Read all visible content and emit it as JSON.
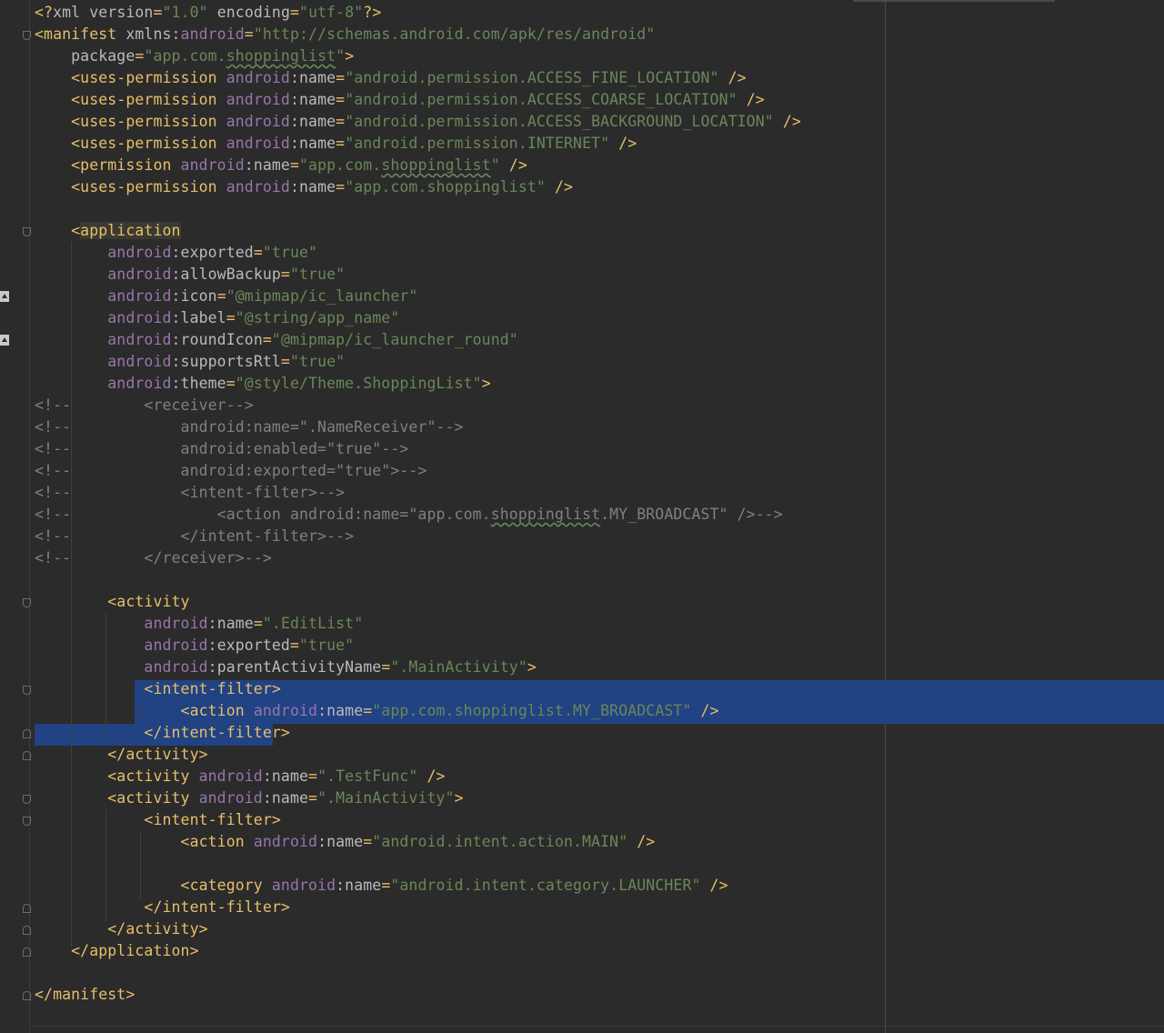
{
  "editor": {
    "lines": [
      {
        "n": 1,
        "segs": [
          [
            "tag",
            "<?"
          ],
          [
            "attr",
            "xml "
          ],
          [
            "attr",
            "version"
          ],
          [
            "tag",
            "="
          ],
          [
            "val",
            "\"1.0\""
          ],
          [
            "attr",
            " encoding"
          ],
          [
            "tag",
            "="
          ],
          [
            "val",
            "\"utf-8\""
          ],
          [
            "tag",
            "?>"
          ]
        ]
      },
      {
        "n": 2,
        "segs": [
          [
            "tag",
            "<manifest "
          ],
          [
            "attr",
            "xmlns:"
          ],
          [
            "ns",
            "android"
          ],
          [
            "tag",
            "="
          ],
          [
            "val",
            "\"http://schemas.android.com/apk/res/android\""
          ]
        ]
      },
      {
        "n": 3,
        "segs": [
          [
            "attr",
            "    package"
          ],
          [
            "tag",
            "="
          ],
          [
            "val",
            "\"app.com."
          ],
          [
            "valsq",
            "shoppinglist"
          ],
          [
            "val",
            "\""
          ],
          [
            "tag",
            ">"
          ]
        ]
      },
      {
        "n": 4,
        "segs": [
          [
            "tag",
            "    <uses-permission "
          ],
          [
            "ns",
            "android"
          ],
          [
            "attr",
            ":name"
          ],
          [
            "tag",
            "="
          ],
          [
            "val",
            "\"android.permission.ACCESS_FINE_LOCATION\""
          ],
          [
            "tag",
            " />"
          ]
        ]
      },
      {
        "n": 5,
        "segs": [
          [
            "tag",
            "    <uses-permission "
          ],
          [
            "ns",
            "android"
          ],
          [
            "attr",
            ":name"
          ],
          [
            "tag",
            "="
          ],
          [
            "val",
            "\"android.permission.ACCESS_COARSE_LOCATION\""
          ],
          [
            "tag",
            " />"
          ]
        ]
      },
      {
        "n": 6,
        "segs": [
          [
            "tag",
            "    <uses-permission "
          ],
          [
            "ns",
            "android"
          ],
          [
            "attr",
            ":name"
          ],
          [
            "tag",
            "="
          ],
          [
            "val",
            "\"android.permission.ACCESS_BACKGROUND_LOCATION\""
          ],
          [
            "tag",
            " />"
          ]
        ]
      },
      {
        "n": 7,
        "segs": [
          [
            "tag",
            "    <uses-permission "
          ],
          [
            "ns",
            "android"
          ],
          [
            "attr",
            ":name"
          ],
          [
            "tag",
            "="
          ],
          [
            "val",
            "\"android.permission.INTERNET\""
          ],
          [
            "tag",
            " />"
          ]
        ]
      },
      {
        "n": 8,
        "segs": [
          [
            "tag",
            "    <permission "
          ],
          [
            "ns",
            "android"
          ],
          [
            "attr",
            ":name"
          ],
          [
            "tag",
            "="
          ],
          [
            "val",
            "\"app.com."
          ],
          [
            "valsq",
            "shoppinglist"
          ],
          [
            "val",
            "\""
          ],
          [
            "tag",
            " />"
          ]
        ]
      },
      {
        "n": 9,
        "segs": [
          [
            "tag",
            "    <uses-permission "
          ],
          [
            "ns",
            "android"
          ],
          [
            "attr",
            ":name"
          ],
          [
            "tag",
            "="
          ],
          [
            "val",
            "\"app.com.shoppinglist\""
          ],
          [
            "tag",
            " />"
          ]
        ]
      },
      {
        "n": 10,
        "segs": []
      },
      {
        "n": 11,
        "segs": [
          [
            "tag",
            "    <"
          ],
          [
            "taghl",
            "application"
          ]
        ]
      },
      {
        "n": 12,
        "segs": [
          [
            "ns",
            "        android"
          ],
          [
            "attr",
            ":exported"
          ],
          [
            "tag",
            "="
          ],
          [
            "val",
            "\"true\""
          ]
        ]
      },
      {
        "n": 13,
        "segs": [
          [
            "ns",
            "        android"
          ],
          [
            "attr",
            ":allowBackup"
          ],
          [
            "tag",
            "="
          ],
          [
            "val",
            "\"true\""
          ]
        ]
      },
      {
        "n": 14,
        "segs": [
          [
            "ns",
            "        android"
          ],
          [
            "attr",
            ":icon"
          ],
          [
            "tag",
            "="
          ],
          [
            "val",
            "\"@mipmap/ic_launcher\""
          ]
        ]
      },
      {
        "n": 15,
        "segs": [
          [
            "ns",
            "        android"
          ],
          [
            "attr",
            ":label"
          ],
          [
            "tag",
            "="
          ],
          [
            "val",
            "\"@string/app_name\""
          ]
        ]
      },
      {
        "n": 16,
        "segs": [
          [
            "ns",
            "        android"
          ],
          [
            "attr",
            ":roundIcon"
          ],
          [
            "tag",
            "="
          ],
          [
            "val",
            "\"@mipmap/ic_launcher_round\""
          ]
        ]
      },
      {
        "n": 17,
        "segs": [
          [
            "ns",
            "        android"
          ],
          [
            "attr",
            ":supportsRtl"
          ],
          [
            "tag",
            "="
          ],
          [
            "val",
            "\"true\""
          ]
        ]
      },
      {
        "n": 18,
        "segs": [
          [
            "ns",
            "        android"
          ],
          [
            "attr",
            ":theme"
          ],
          [
            "tag",
            "="
          ],
          [
            "val",
            "\"@style/Theme.ShoppingList\""
          ],
          [
            "tag",
            ">"
          ]
        ]
      },
      {
        "n": 19,
        "segs": [
          [
            "cm",
            "<!--        <receiver-->"
          ]
        ]
      },
      {
        "n": 20,
        "segs": [
          [
            "cm",
            "<!--            android:name=\".NameReceiver\"-->"
          ]
        ]
      },
      {
        "n": 21,
        "segs": [
          [
            "cm",
            "<!--            android:enabled=\"true\"-->"
          ]
        ]
      },
      {
        "n": 22,
        "segs": [
          [
            "cm",
            "<!--            android:exported=\"true\">-->"
          ]
        ]
      },
      {
        "n": 23,
        "segs": [
          [
            "cm",
            "<!--            <intent-filter>-->"
          ]
        ]
      },
      {
        "n": 24,
        "segs": [
          [
            "cm",
            "<!--                <action android:name=\"app.com."
          ],
          [
            "cmsq",
            "shoppinglist"
          ],
          [
            "cm",
            ".MY_BROADCAST\" />-->"
          ]
        ]
      },
      {
        "n": 25,
        "segs": [
          [
            "cm",
            "<!--            </intent-filter>-->"
          ]
        ]
      },
      {
        "n": 26,
        "segs": [
          [
            "cm",
            "<!--        </receiver>-->"
          ]
        ]
      },
      {
        "n": 27,
        "segs": []
      },
      {
        "n": 28,
        "segs": [
          [
            "tag",
            "        <activity"
          ]
        ]
      },
      {
        "n": 29,
        "segs": [
          [
            "ns",
            "            android"
          ],
          [
            "attr",
            ":name"
          ],
          [
            "tag",
            "="
          ],
          [
            "val",
            "\".EditList\""
          ]
        ]
      },
      {
        "n": 30,
        "segs": [
          [
            "ns",
            "            android"
          ],
          [
            "attr",
            ":exported"
          ],
          [
            "tag",
            "="
          ],
          [
            "val",
            "\"true\""
          ]
        ]
      },
      {
        "n": 31,
        "segs": [
          [
            "ns",
            "            android"
          ],
          [
            "attr",
            ":parentActivityName"
          ],
          [
            "tag",
            "="
          ],
          [
            "val",
            "\".MainActivity\""
          ],
          [
            "tag",
            ">"
          ]
        ]
      },
      {
        "n": 32,
        "segs": [
          [
            "tag",
            "            <intent-filter>"
          ]
        ]
      },
      {
        "n": 33,
        "segs": [
          [
            "tag",
            "                <action "
          ],
          [
            "ns",
            "android"
          ],
          [
            "attr",
            ":name"
          ],
          [
            "tag",
            "="
          ],
          [
            "val",
            "\"app.com.shoppinglist.MY_BROADCAST\""
          ],
          [
            "tag",
            " />"
          ]
        ]
      },
      {
        "n": 34,
        "segs": [
          [
            "tag",
            "            </intent-filter>"
          ]
        ]
      },
      {
        "n": 35,
        "segs": [
          [
            "tag",
            "        </activity>"
          ]
        ]
      },
      {
        "n": 36,
        "segs": [
          [
            "tag",
            "        <activity "
          ],
          [
            "ns",
            "android"
          ],
          [
            "attr",
            ":name"
          ],
          [
            "tag",
            "="
          ],
          [
            "val",
            "\".TestFunc\""
          ],
          [
            "tag",
            " />"
          ]
        ]
      },
      {
        "n": 37,
        "segs": [
          [
            "tag",
            "        <activity "
          ],
          [
            "ns",
            "android"
          ],
          [
            "attr",
            ":name"
          ],
          [
            "tag",
            "="
          ],
          [
            "val",
            "\".MainActivity\""
          ],
          [
            "tag",
            ">"
          ]
        ]
      },
      {
        "n": 38,
        "segs": [
          [
            "tag",
            "            <intent-filter>"
          ]
        ]
      },
      {
        "n": 39,
        "segs": [
          [
            "tag",
            "                <action "
          ],
          [
            "ns",
            "android"
          ],
          [
            "attr",
            ":name"
          ],
          [
            "tag",
            "="
          ],
          [
            "val",
            "\"android.intent.action.MAIN\""
          ],
          [
            "tag",
            " />"
          ]
        ]
      },
      {
        "n": 40,
        "segs": []
      },
      {
        "n": 41,
        "segs": [
          [
            "tag",
            "                <category "
          ],
          [
            "ns",
            "android"
          ],
          [
            "attr",
            ":name"
          ],
          [
            "tag",
            "="
          ],
          [
            "val",
            "\"android.intent.category.LAUNCHER\""
          ],
          [
            "tag",
            " />"
          ]
        ]
      },
      {
        "n": 42,
        "segs": [
          [
            "tag",
            "            </intent-filter>"
          ]
        ]
      },
      {
        "n": 43,
        "segs": [
          [
            "tag",
            "        </activity>"
          ]
        ]
      },
      {
        "n": 44,
        "segs": [
          [
            "tag",
            "    </application>"
          ]
        ]
      },
      {
        "n": 45,
        "segs": []
      },
      {
        "n": 46,
        "segs": [
          [
            "tag",
            "</manifest>"
          ]
        ]
      }
    ]
  },
  "colors": {
    "background": "#2b2b2b",
    "tag": "#e8bf6a",
    "namespace": "#9876aa",
    "attribute": "#bababa",
    "value": "#6a8759",
    "comment": "#808080",
    "selection": "#214283"
  }
}
